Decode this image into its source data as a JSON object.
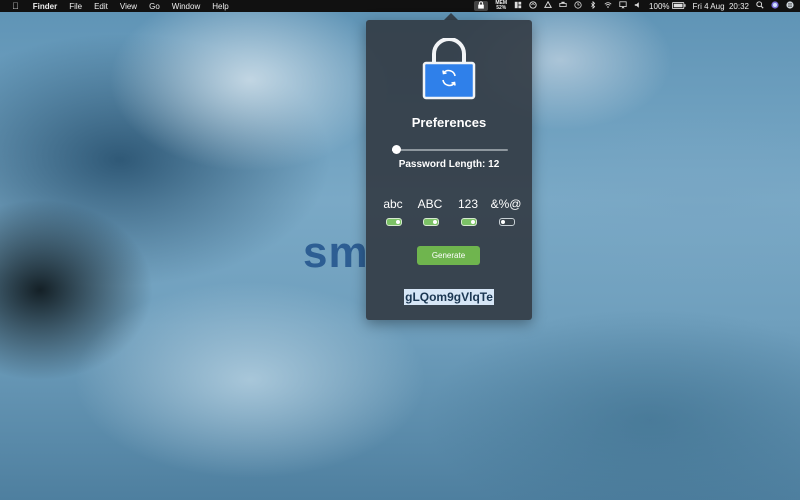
{
  "menubar": {
    "app_name": "Finder",
    "menus": [
      "File",
      "Edit",
      "View",
      "Go",
      "Window",
      "Help"
    ],
    "mem_label": "MEM",
    "mem_value": "52%",
    "battery": "100%",
    "datetime": "Fri 4 Aug  20:32",
    "icons": [
      "apple-icon",
      "lock-icon",
      "grid-icon",
      "backup-icon",
      "drive-icon",
      "printer-icon",
      "clock-icon",
      "bluetooth-icon",
      "wifi-icon",
      "airplay-icon",
      "volume-icon",
      "battery-icon",
      "search-icon",
      "siri-icon",
      "notifications-icon"
    ]
  },
  "desktop": {
    "background_text": "sm"
  },
  "popover": {
    "title": "Preferences",
    "length_label": "Password Length: 12",
    "slider": {
      "value": 12,
      "min": 10,
      "max": 64
    },
    "options": [
      {
        "label": "abc",
        "enabled": true
      },
      {
        "label": "ABC",
        "enabled": true
      },
      {
        "label": "123",
        "enabled": true
      },
      {
        "label": "&%@",
        "enabled": false
      }
    ],
    "generate_label": "Generate",
    "password": "gLQom9gVlqTe",
    "colors": {
      "lock_blue": "#2f80ea",
      "generate_green": "#6fb54e",
      "toggle_on": "#7cc266"
    }
  }
}
